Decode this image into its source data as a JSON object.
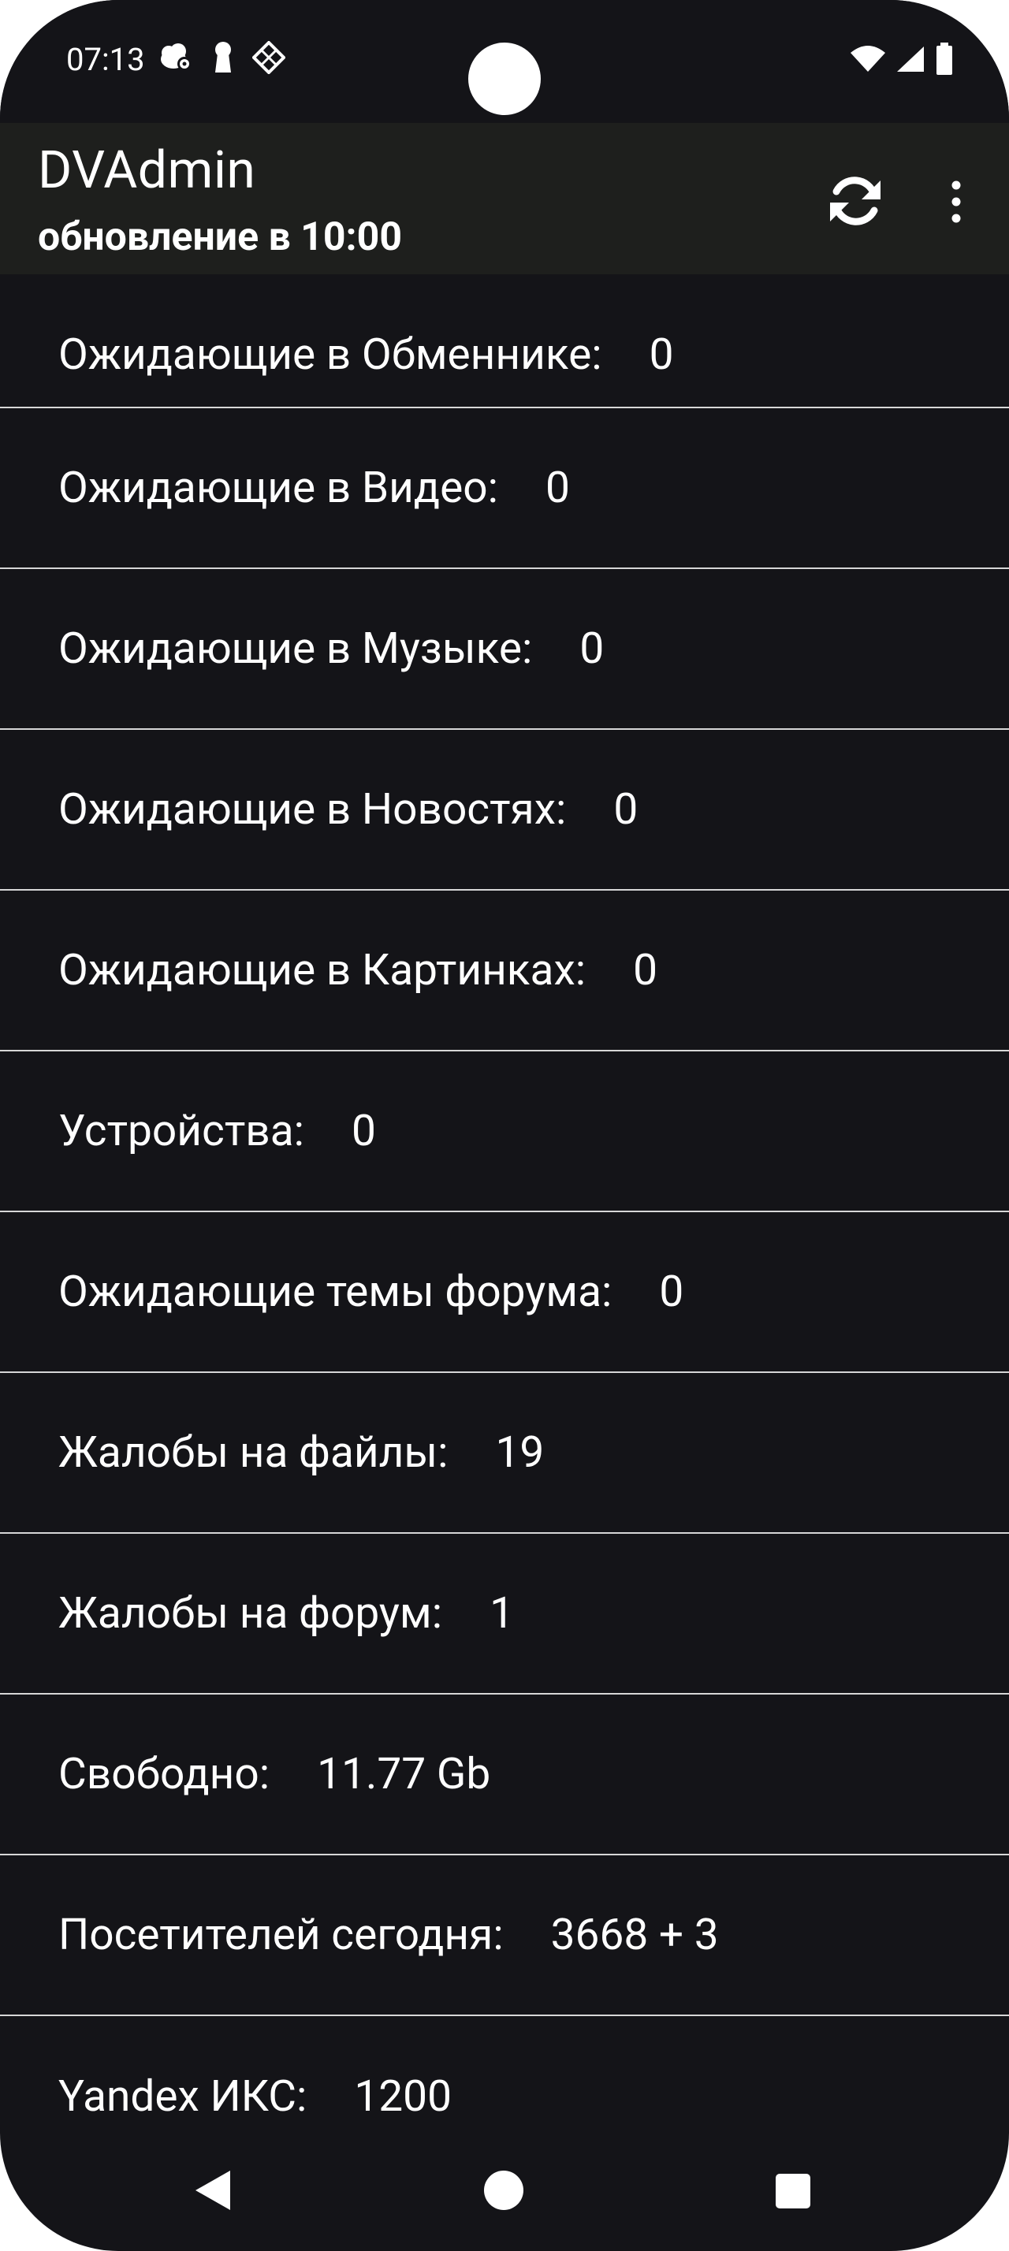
{
  "status_bar": {
    "time": "07:13",
    "icons_left": [
      "gear-cloud-icon",
      "keyhole-icon",
      "diamond-grid-icon"
    ],
    "icons_right": [
      "wifi-icon",
      "signal-icon",
      "battery-icon"
    ]
  },
  "app_bar": {
    "title": "DVAdmin",
    "subtitle": "обновление в 10:00",
    "actions": [
      "refresh-icon",
      "more-vert-icon"
    ]
  },
  "stats": [
    {
      "label": "Ожидающие в Обменнике:",
      "value": "0"
    },
    {
      "label": "Ожидающие в Видео:",
      "value": "0"
    },
    {
      "label": "Ожидающие в Музыке:",
      "value": "0"
    },
    {
      "label": "Ожидающие в Новостях:",
      "value": "0"
    },
    {
      "label": "Ожидающие в Картинках:",
      "value": "0"
    },
    {
      "label": "Устройства:",
      "value": "0"
    },
    {
      "label": "Ожидающие темы форума:",
      "value": "0"
    },
    {
      "label": "Жалобы на файлы:",
      "value": "19"
    },
    {
      "label": "Жалобы на форум:",
      "value": "1"
    },
    {
      "label": "Свободно:",
      "value": "11.77 Gb"
    },
    {
      "label": "Посетителей сегодня:",
      "value": "3668 + 3"
    },
    {
      "label": "Yandex ИКС:",
      "value": "1200"
    }
  ],
  "colors": {
    "background": "#141418",
    "app_bar": "#1e1f1d",
    "divider": "#d7d7d7",
    "text": "#ffffff"
  }
}
